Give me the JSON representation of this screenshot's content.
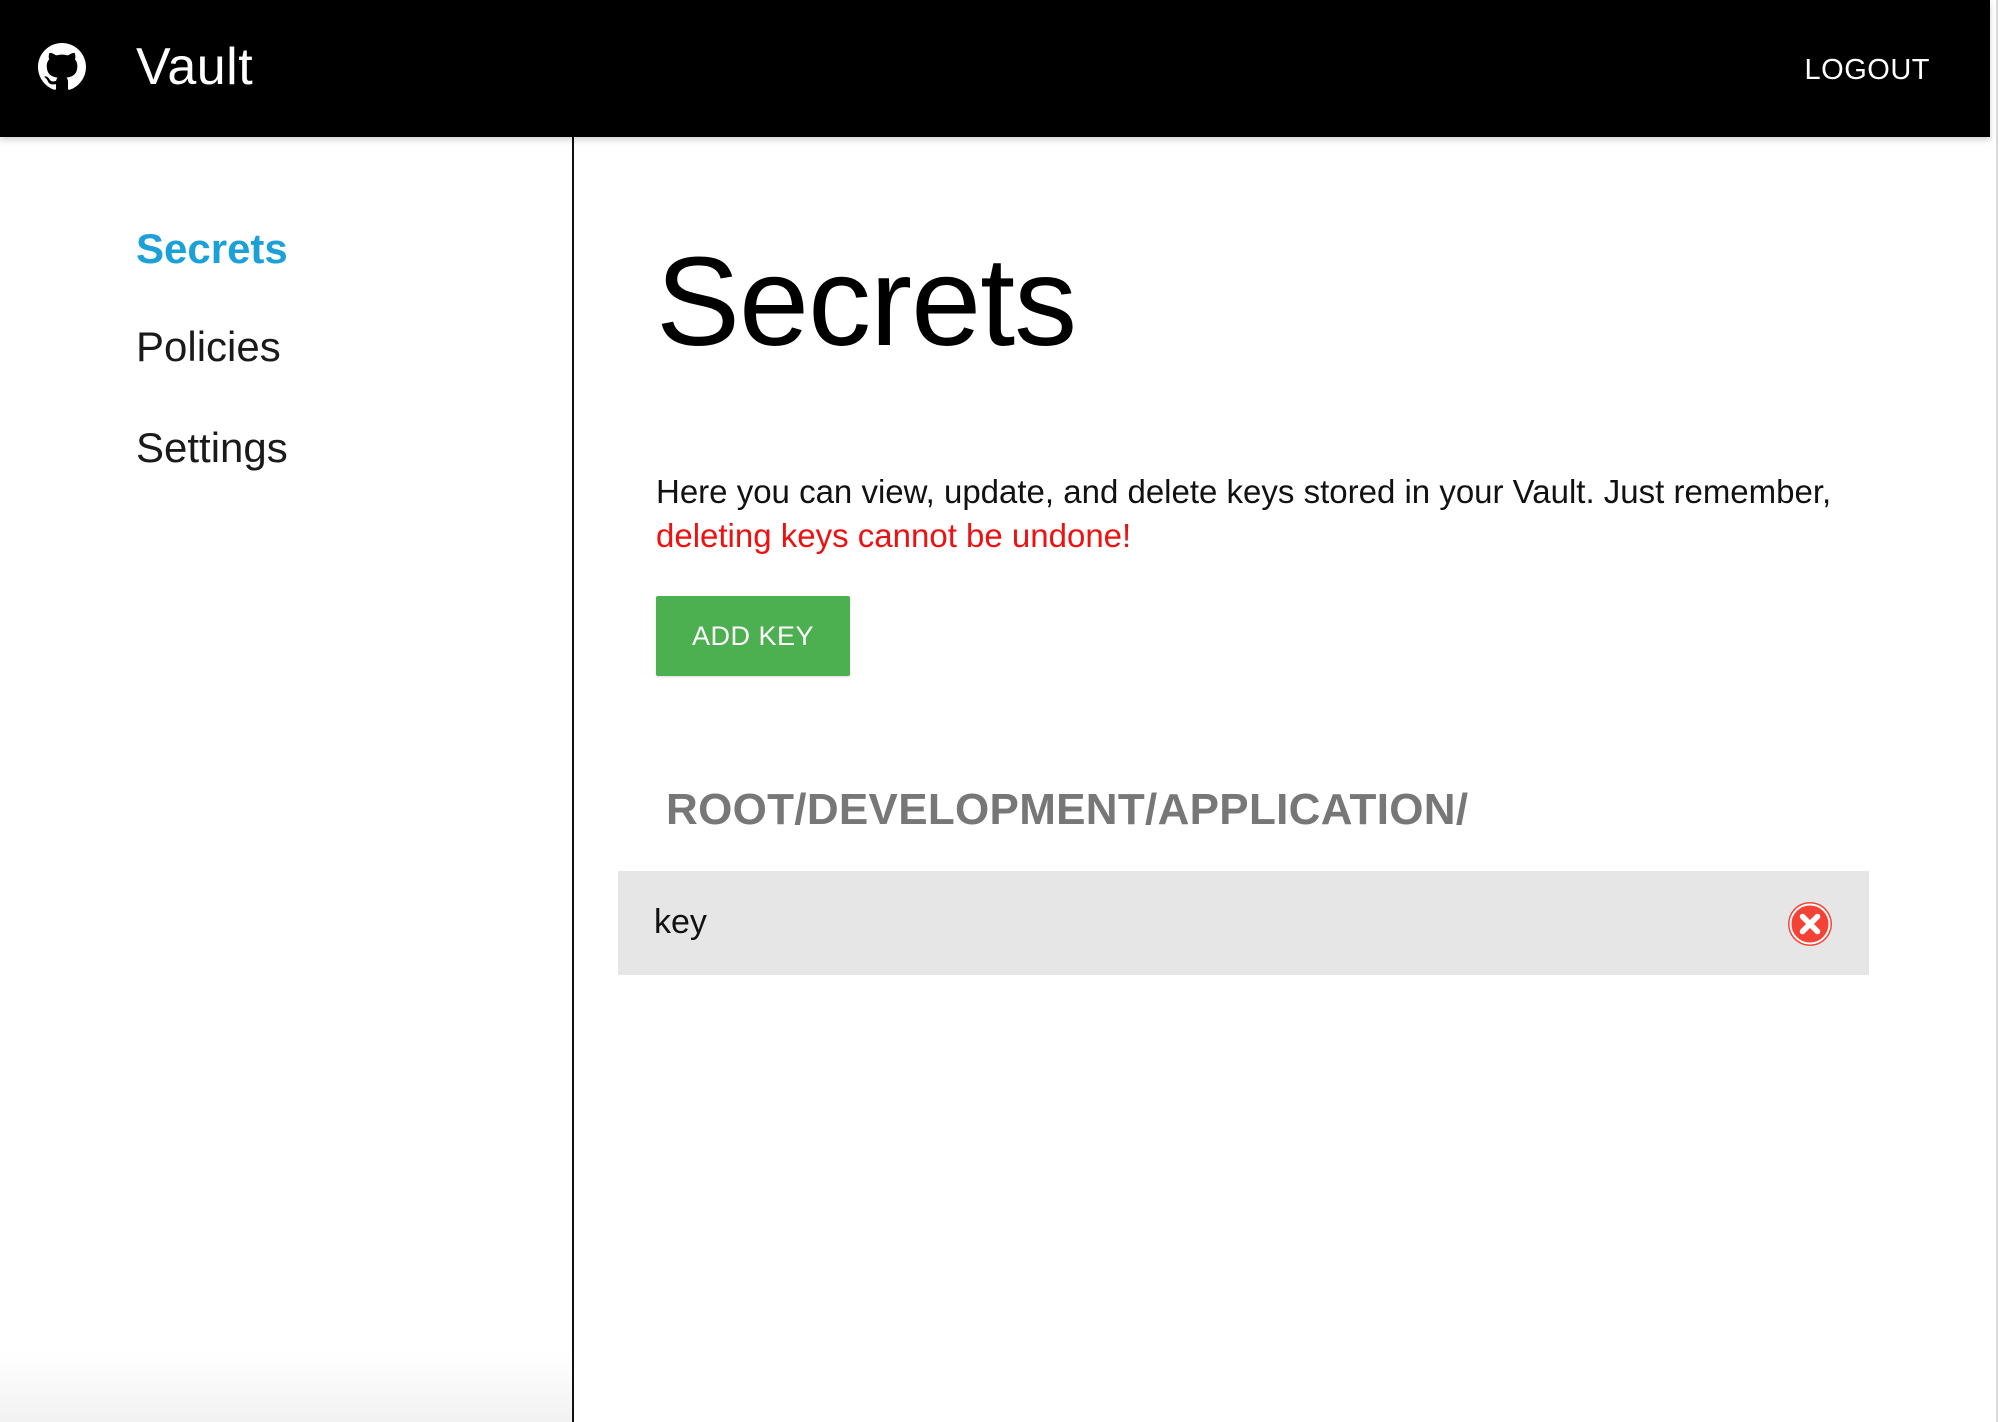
{
  "header": {
    "app_title": "Vault",
    "logo_icon": "github-icon",
    "logout_label": "LOGOUT",
    "background": "#000000"
  },
  "sidebar": {
    "items": [
      {
        "label": "Secrets",
        "active": true
      },
      {
        "label": "Policies",
        "active": false
      },
      {
        "label": "Settings",
        "active": false
      }
    ],
    "active_color": "#1ba1d8"
  },
  "main": {
    "title": "Secrets",
    "intro_text": "Here you can view, update, and delete keys stored in your Vault. Just remember,",
    "warning_text": "deleting keys cannot be undone!",
    "warning_color": "#ee1111",
    "add_key_label": "ADD KEY",
    "add_key_color": "#4caf50",
    "path": "ROOT/DEVELOPMENT/APPLICATION/",
    "keys": [
      {
        "name": "key",
        "action_icon": "delete-circle-x-icon"
      }
    ],
    "delete_color": "#f44336"
  }
}
